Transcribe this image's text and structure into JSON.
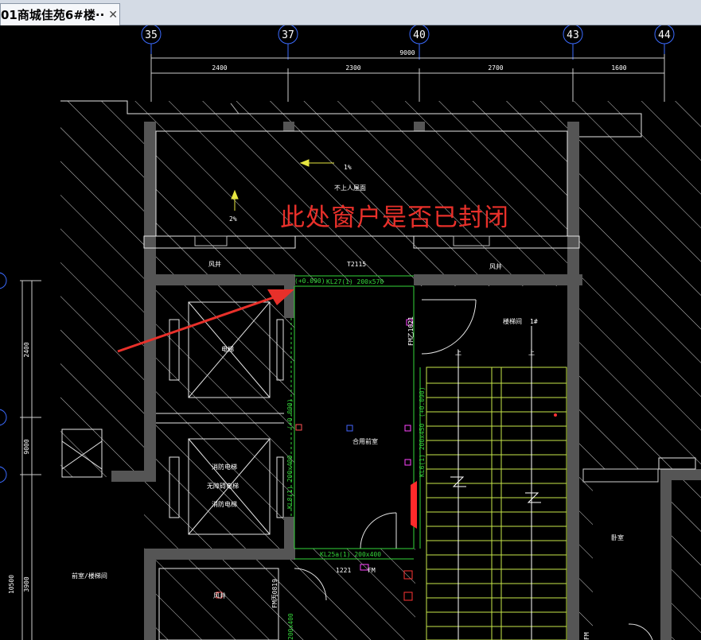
{
  "tab": {
    "title": "01商城佳苑6#楼··",
    "close_glyph": "✕"
  },
  "grid_axes": [
    "35",
    "37",
    "40",
    "43",
    "44"
  ],
  "dimensions": {
    "total": "9000",
    "spans": [
      "2400",
      "2300",
      "2700",
      "1600"
    ],
    "left_spans": [
      "2400",
      "9000"
    ],
    "left_bottom": [
      "10500",
      "3900"
    ]
  },
  "annotation": "此处窗户是否已封闭",
  "labels": {
    "slope1": "1%",
    "slope2": "2%",
    "no_entry": "不上人屋面",
    "window_top": "T2115",
    "wind_left": "风井",
    "wind_right": "风井",
    "beam_top": "KL27(1) 200x570",
    "elev": "(+0.090)",
    "fm_right": "FM乙1021",
    "stair": "楼梯间",
    "stair_num": "1#",
    "up1": "上",
    "up2": "上",
    "elev_car": "电梯",
    "elev_fire1": "消防电梯",
    "elev_fire2": "无障碍电梯",
    "elev_fire3": "消防电梯",
    "lobby": "合用前室",
    "beam_left": "KL8(1) 200x400",
    "beam_right": "KL6(1) 200x450",
    "dim_left_v": "(+0.090)",
    "dim_right_v": "(+0.090)",
    "beam_bottom": "KL25a(1) 200x400",
    "door_bottom": "1221",
    "fm_bottom": "FM",
    "fm_left": "FM丙0819",
    "wind_bottom": "风井",
    "room_left": "前室/楼梯间",
    "room_right": "卧室",
    "dim_bottom_left": "200x400",
    "fm_bottom_right": "FM"
  }
}
